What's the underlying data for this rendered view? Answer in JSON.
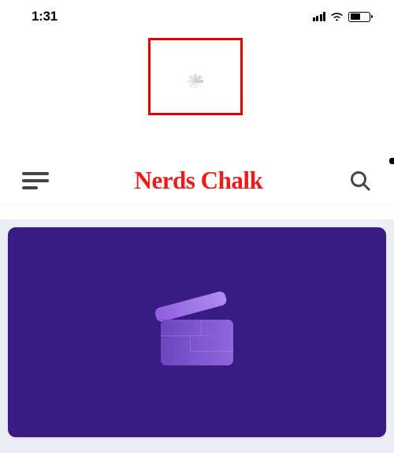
{
  "status_bar": {
    "time": "1:31"
  },
  "site": {
    "logo_text": "Nerds Chalk"
  },
  "loading": {
    "state": "loading"
  },
  "colors": {
    "accent": "#ef1a1a",
    "annotation": "#e30000",
    "card_bg": "#381c82"
  }
}
